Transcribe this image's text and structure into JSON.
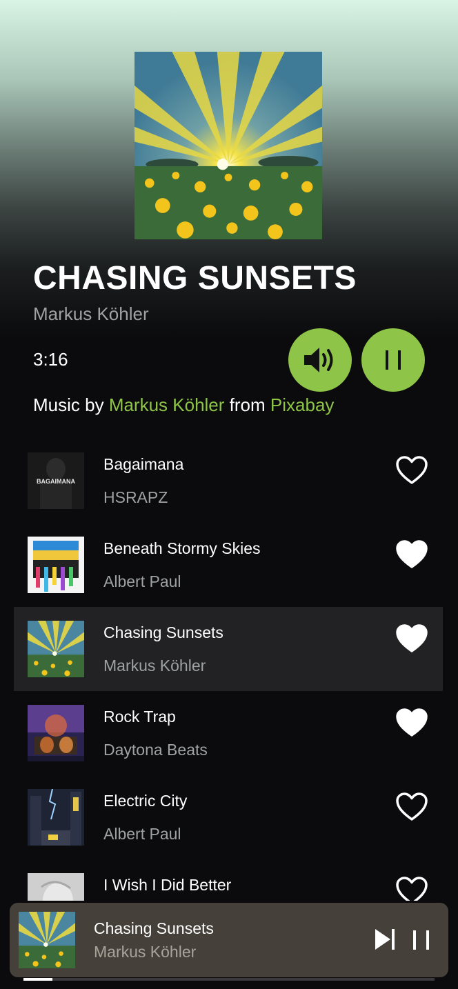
{
  "now_playing": {
    "title": "CHASING SUNSETS",
    "artist": "Markus Köhler",
    "duration": "3:16"
  },
  "credit": {
    "prefix": "Music by",
    "author": "Markus Köhler",
    "middle": "from",
    "source": "Pixabay"
  },
  "controls": {
    "volume_icon": "speaker-volume-icon",
    "pause_icon": "pause-icon"
  },
  "tracks": [
    {
      "title": "Bagaimana",
      "artist": "HSRAPZ",
      "liked": false,
      "active": false,
      "cover_text": "BAGAIMANA"
    },
    {
      "title": "Beneath Stormy Skies",
      "artist": "Albert Paul",
      "liked": true,
      "active": false
    },
    {
      "title": "Chasing Sunsets",
      "artist": "Markus Köhler",
      "liked": true,
      "active": true
    },
    {
      "title": "Rock Trap",
      "artist": "Daytona Beats",
      "liked": true,
      "active": false
    },
    {
      "title": "Electric City",
      "artist": "Albert Paul",
      "liked": false,
      "active": false
    },
    {
      "title": "I Wish I Did Better",
      "artist": "",
      "liked": false,
      "active": false
    }
  ],
  "mini_player": {
    "title": "Chasing Sunsets",
    "artist": "Markus Köhler",
    "progress": 0.07
  },
  "colors": {
    "accent": "#8ec447",
    "active_row": "#222224",
    "mini_player_bg": "#45403a",
    "muted_text": "#9ea3a1"
  }
}
